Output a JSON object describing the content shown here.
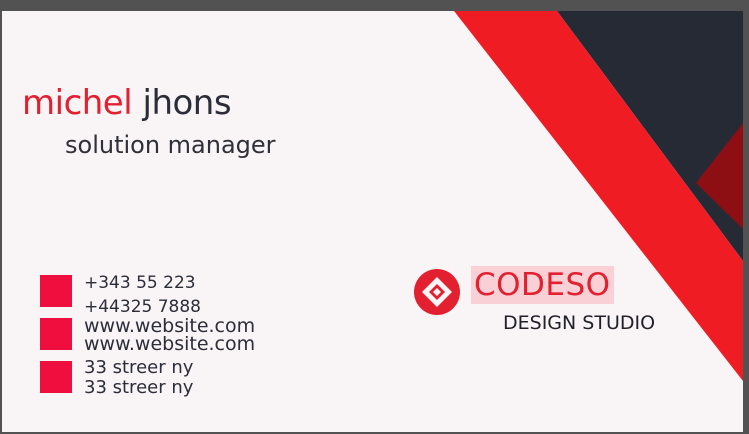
{
  "card": {
    "first_name": "michel",
    "last_name": "jhons",
    "title": "solution manager",
    "contacts": {
      "phones": [
        "+343 55 223",
        "+44325 7888"
      ],
      "websites": [
        "www.website.com",
        "www.website.com"
      ],
      "addresses": [
        "33 streer ny",
        "33 streer ny"
      ]
    },
    "brand": {
      "name": "CODESO",
      "tagline": "DESIGN STUDIO"
    }
  },
  "colors": {
    "accent_red": "#e3202f",
    "dark_navy": "#262a34",
    "dark_red": "#8d0f14",
    "contact_square": "#ee0f3e",
    "background": "#f9f4f6"
  },
  "icons": {
    "brand_logo": "diamond-in-circle-icon",
    "contact_markers": "square-icon"
  }
}
